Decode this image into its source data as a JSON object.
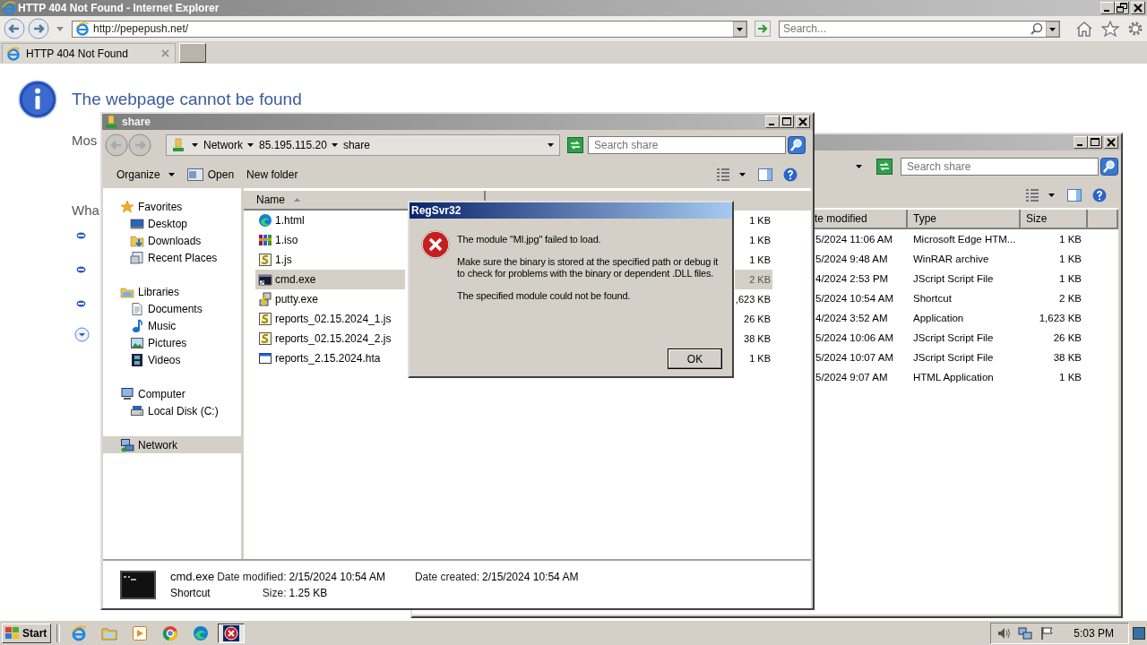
{
  "browser": {
    "title": "HTTP 404 Not Found - Internet Explorer",
    "address": "http://pepepush.net/",
    "search": {
      "placeholder": "Search..."
    },
    "tabs": [
      {
        "label": "HTTP 404 Not Found",
        "selected": true
      }
    ],
    "heading": "The webpage cannot be found",
    "sections": [
      {
        "text": "Mos"
      },
      {
        "text": "Wha",
        "bullets": [
          {
            "kind": "dot"
          },
          {
            "kind": "dot"
          },
          {
            "kind": "dot"
          },
          {
            "kind": "expand"
          }
        ]
      }
    ]
  },
  "back_explorer": {
    "search": {
      "placeholder": "Search share"
    },
    "columns": [
      "te modified",
      "Type",
      "Size"
    ],
    "rows": [
      {
        "date": "5/2024 11:06 AM",
        "type": "Microsoft Edge HTM...",
        "size": "1 KB"
      },
      {
        "date": "5/2024 9:48 AM",
        "type": "WinRAR archive",
        "size": "1 KB"
      },
      {
        "date": "4/2024 2:53 PM",
        "type": "JScript Script File",
        "size": "1 KB"
      },
      {
        "date": "5/2024 10:54 AM",
        "type": "Shortcut",
        "size": "2 KB"
      },
      {
        "date": "4/2024 3:52 AM",
        "type": "Application",
        "size": "1,623 KB"
      },
      {
        "date": "5/2024 10:06 AM",
        "type": "JScript Script File",
        "size": "26 KB"
      },
      {
        "date": "5/2024 10:07 AM",
        "type": "JScript Script File",
        "size": "38 KB"
      },
      {
        "date": "5/2024 9:07 AM",
        "type": "HTML Application",
        "size": "1 KB"
      }
    ]
  },
  "explorer": {
    "title": "share",
    "breadcrumb": [
      "Network",
      "85.195.115.20",
      "share"
    ],
    "search": {
      "placeholder": "Search share"
    },
    "toolbar": [
      "Organize",
      "Open",
      "New folder"
    ],
    "nav": [
      {
        "label": "Favorites",
        "selected": false,
        "children": [
          {
            "label": "Desktop",
            "selected": false
          },
          {
            "label": "Downloads",
            "selected": false
          },
          {
            "label": "Recent Places",
            "selected": false
          }
        ]
      },
      {
        "label": "Libraries",
        "selected": false,
        "children": [
          {
            "label": "Documents",
            "selected": false
          },
          {
            "label": "Music",
            "selected": false
          },
          {
            "label": "Pictures",
            "selected": false
          },
          {
            "label": "Videos",
            "selected": false
          }
        ]
      },
      {
        "label": "Computer",
        "selected": false,
        "children": [
          {
            "label": "Local Disk (C:)",
            "selected": false
          }
        ]
      },
      {
        "label": "Network",
        "selected": true
      }
    ],
    "columns": [
      "Name"
    ],
    "files": [
      {
        "name": "1.html",
        "kind": "html",
        "size": "1 KB",
        "selected": false
      },
      {
        "name": "1.iso",
        "kind": "iso",
        "size": "1 KB",
        "selected": false
      },
      {
        "name": "1.js",
        "kind": "js",
        "size": "1 KB",
        "selected": false
      },
      {
        "name": "cmd.exe",
        "kind": "shortcut",
        "size": "2 KB",
        "selected": true
      },
      {
        "name": "putty.exe",
        "kind": "exe",
        "size": ",623 KB",
        "selected": false
      },
      {
        "name": "reports_02.15.2024_1.js",
        "kind": "js",
        "size": "26 KB",
        "selected": false
      },
      {
        "name": "reports_02.15.2024_2.js",
        "kind": "js",
        "size": "38 KB",
        "selected": false
      },
      {
        "name": "reports_2.15.2024.hta",
        "kind": "hta",
        "size": "1 KB",
        "selected": false
      }
    ],
    "details": {
      "name": "cmd.exe",
      "type": "Shortcut",
      "fields": [
        {
          "label": "Date modified:",
          "value": "2/15/2024 10:54 AM"
        },
        {
          "label": "Date created:",
          "value": "2/15/2024 10:54 AM"
        },
        {
          "label": "Size:",
          "value": "1.25 KB"
        }
      ]
    }
  },
  "dialog": {
    "title": "RegSvr32",
    "paragraphs": [
      "The module \"MI.jpg\" failed to load.",
      "Make sure the binary is stored at the specified path or debug it to check for problems with the binary or dependent .DLL files.",
      "The specified module could not be found."
    ],
    "button": "OK"
  },
  "taskbar": {
    "start": "Start",
    "time": "5:03 PM",
    "apps": [
      {
        "kind": "ie",
        "active": false
      },
      {
        "kind": "explorer",
        "active": false
      },
      {
        "kind": "media",
        "active": false
      },
      {
        "kind": "chrome",
        "active": false
      },
      {
        "kind": "edge",
        "active": false
      },
      {
        "kind": "error",
        "active": true
      }
    ]
  }
}
